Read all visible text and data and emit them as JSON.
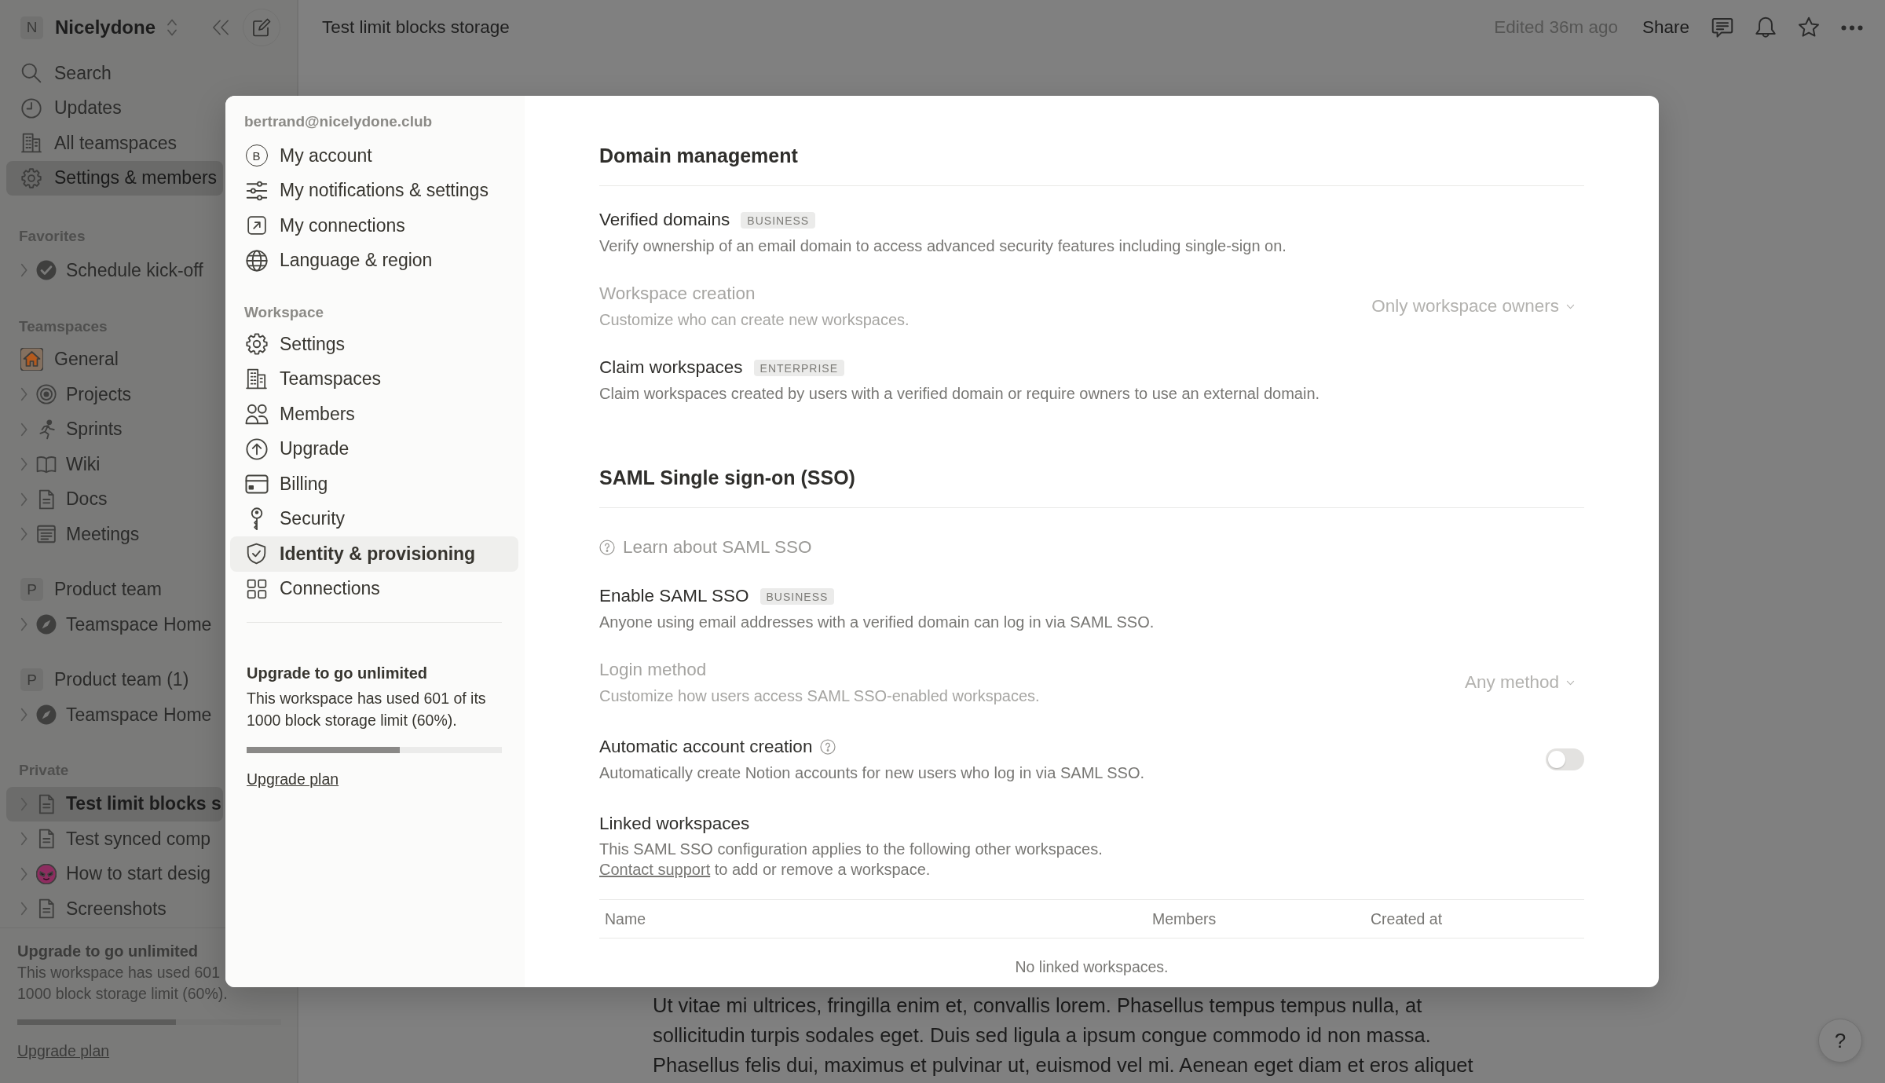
{
  "sidebar": {
    "workspace": {
      "initial": "N",
      "name": "Nicelydone"
    },
    "nav": [
      {
        "label": "Search",
        "selected": false
      },
      {
        "label": "Updates",
        "selected": false
      },
      {
        "label": "All teamspaces",
        "selected": false
      },
      {
        "label": "Settings & members",
        "selected": true
      }
    ],
    "favorites": {
      "label": "Favorites",
      "pages": [
        {
          "label": "Schedule kick-off",
          "selected": false,
          "expanded": false
        }
      ]
    },
    "teamspaces": {
      "label": "Teamspaces",
      "groups": [
        {
          "name": "General",
          "pages": [
            {
              "label": "Projects",
              "selected": false,
              "expanded": false
            },
            {
              "label": "Sprints",
              "selected": false,
              "expanded": false
            },
            {
              "label": "Wiki",
              "selected": false,
              "expanded": false
            },
            {
              "label": "Docs",
              "selected": false,
              "expanded": false
            },
            {
              "label": "Meetings",
              "selected": false,
              "expanded": false
            }
          ]
        },
        {
          "name": "Product team",
          "initial": "P",
          "pages": [
            {
              "label": "Teamspace Home",
              "selected": false,
              "expanded": false
            }
          ]
        },
        {
          "name": "Product team (1)",
          "initial": "P",
          "pages": [
            {
              "label": "Teamspace Home",
              "selected": false,
              "expanded": false
            }
          ]
        }
      ]
    },
    "private": {
      "label": "Private",
      "pages": [
        {
          "label": "Test limit blocks s",
          "selected": true,
          "expanded": false
        },
        {
          "label": "Test synced comp",
          "selected": false,
          "expanded": false
        },
        {
          "label": "How to start desig",
          "selected": false,
          "expanded": false
        },
        {
          "label": "Screenshots",
          "selected": false,
          "expanded": false
        }
      ]
    },
    "upgrade": {
      "title": "Upgrade to go unlimited",
      "text_lines": [
        "This workspace has used 601",
        "1000 block storage limit (60%)."
      ],
      "level": 0.6,
      "link": "Upgrade plan"
    }
  },
  "topbar": {
    "title": "Test limit blocks storage",
    "edited": "Edited 36m ago",
    "share": "Share"
  },
  "settings_modal": {
    "nav": {
      "account_email": "bertrand@nicelydone.club",
      "account_items": [
        {
          "label": "My account",
          "initial": "B",
          "selected": false
        },
        {
          "label": "My notifications & settings",
          "selected": false
        },
        {
          "label": "My connections",
          "selected": false
        },
        {
          "label": "Language & region",
          "selected": false
        }
      ],
      "workspace_label": "Workspace",
      "workspace_items": [
        {
          "label": "Settings",
          "selected": false
        },
        {
          "label": "Teamspaces",
          "selected": false
        },
        {
          "label": "Members",
          "selected": false
        },
        {
          "label": "Upgrade",
          "selected": false
        },
        {
          "label": "Billing",
          "selected": false
        },
        {
          "label": "Security",
          "selected": false
        },
        {
          "label": "Identity & provisioning",
          "selected": true
        },
        {
          "label": "Connections",
          "selected": false
        }
      ],
      "upgrade": {
        "title": "Upgrade to go unlimited",
        "text": "This workspace has used 601 of its 1000 block storage limit (60%).",
        "level": 0.6,
        "link": "Upgrade plan"
      }
    },
    "sections": [
      {
        "title": "Domain management",
        "items": [
          {
            "kind": "setting",
            "title": "Verified domains",
            "badge": "BUSINESS",
            "description": "Verify ownership of an email domain to access advanced security features including single-sign on.",
            "disabled": false
          },
          {
            "kind": "dropdown",
            "title": "Workspace creation",
            "description": "Customize who can create new workspaces.",
            "value": "Only workspace owners",
            "disabled": true
          },
          {
            "kind": "setting",
            "title": "Claim workspaces",
            "badge": "ENTERPRISE",
            "description": "Claim workspaces created by users with a verified domain or require owners to use an external domain.",
            "disabled": false
          }
        ]
      },
      {
        "title": "SAML Single sign-on (SSO)",
        "items": [
          {
            "kind": "link",
            "title": "Learn about SAML SSO",
            "disabled": false
          },
          {
            "kind": "setting",
            "title": "Enable SAML SSO",
            "badge": "BUSINESS",
            "description": "Anyone using email addresses with a verified domain can log in via SAML SSO.",
            "disabled": false
          },
          {
            "kind": "dropdown",
            "title": "Login method",
            "description": "Customize how users access SAML SSO-enabled workspaces.",
            "value": "Any method",
            "disabled": true
          },
          {
            "kind": "toggle",
            "title": "Automatic account creation",
            "help": true,
            "description": "Automatically create Notion accounts for new users who log in via SAML SSO.",
            "on": false,
            "disabled": false
          },
          {
            "kind": "table",
            "title": "Linked workspaces",
            "description": "This SAML SSO configuration applies to the following other workspaces.",
            "link": "Contact support",
            "description_end": "to add or remove a workspace.",
            "columns": [
              "Name",
              "Members",
              "Created at"
            ],
            "empty": "No linked workspaces.",
            "disabled": false
          }
        ]
      }
    ]
  },
  "document": {
    "lines": [
      "Ut vitae mi ultrices, fringilla enim et, convallis lorem. Phasellus tempus tempus nulla, at",
      "sollicitudin turpis sodales eget. Duis sed ligula a ipsum congue commodo id non massa.",
      "Phasellus felis dui, maximus et pulvinar ut, euismod vel mi. Aenean eget diam et eros aliquet"
    ]
  },
  "help_button": {
    "label": "?"
  }
}
